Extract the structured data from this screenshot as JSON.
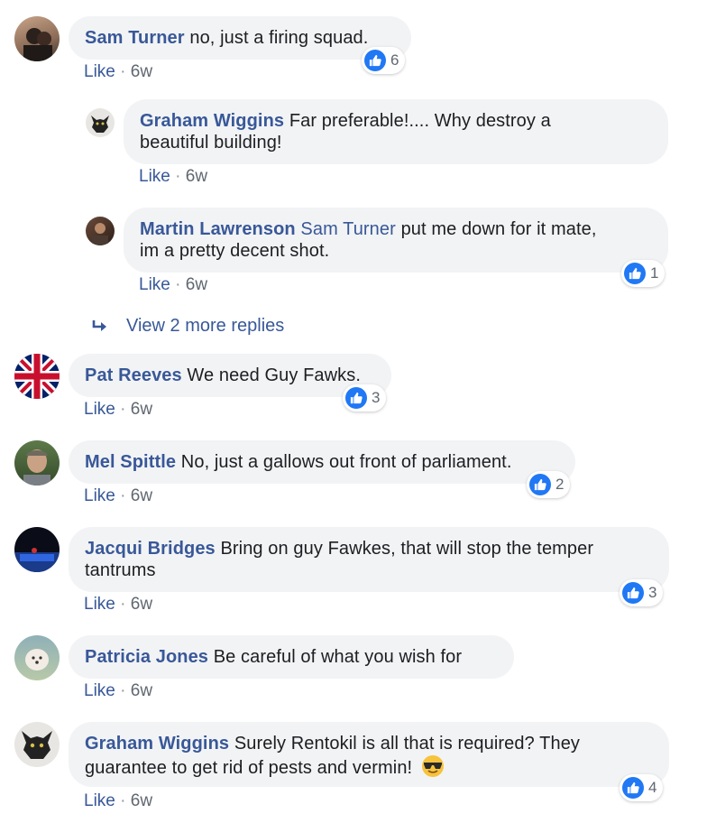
{
  "comments": [
    {
      "author": "Sam Turner",
      "text": "no, just a firing squad.",
      "like": "Like",
      "time": "6w",
      "reactions": "6"
    },
    {
      "author": "Graham Wiggins",
      "text": "Far preferable!.... Why destroy a",
      "text2": "beautiful building!",
      "like": "Like",
      "time": "6w"
    },
    {
      "author": "Martin Lawrenson",
      "mention": "Sam Turner",
      "text": "put me down for it mate,",
      "text2": "im a pretty decent shot.",
      "like": "Like",
      "time": "6w",
      "reactions": "1"
    },
    {
      "author": "Pat Reeves",
      "text": "We need Guy Fawks.",
      "like": "Like",
      "time": "6w",
      "reactions": "3"
    },
    {
      "author": "Mel Spittle",
      "text": "No, just a gallows out front of parliament.",
      "like": "Like",
      "time": "6w",
      "reactions": "2"
    },
    {
      "author": "Jacqui Bridges",
      "text": "Bring on guy Fawkes, that will stop the temper",
      "text2": "tantrums",
      "like": "Like",
      "time": "6w",
      "reactions": "3"
    },
    {
      "author": "Patricia Jones",
      "text": "Be careful of what you wish for",
      "like": "Like",
      "time": "6w"
    },
    {
      "author": "Graham Wiggins",
      "text": "Surely Rentokil is all that is required? They",
      "text2": "guarantee to get rid of pests and vermin!",
      "like": "Like",
      "time": "6w",
      "reactions": "4"
    }
  ],
  "view_more": "View 2 more replies",
  "sep": "·",
  "colors": {
    "link": "#385898",
    "bubble": "#f2f3f5",
    "like_blue": "#2078f4"
  }
}
